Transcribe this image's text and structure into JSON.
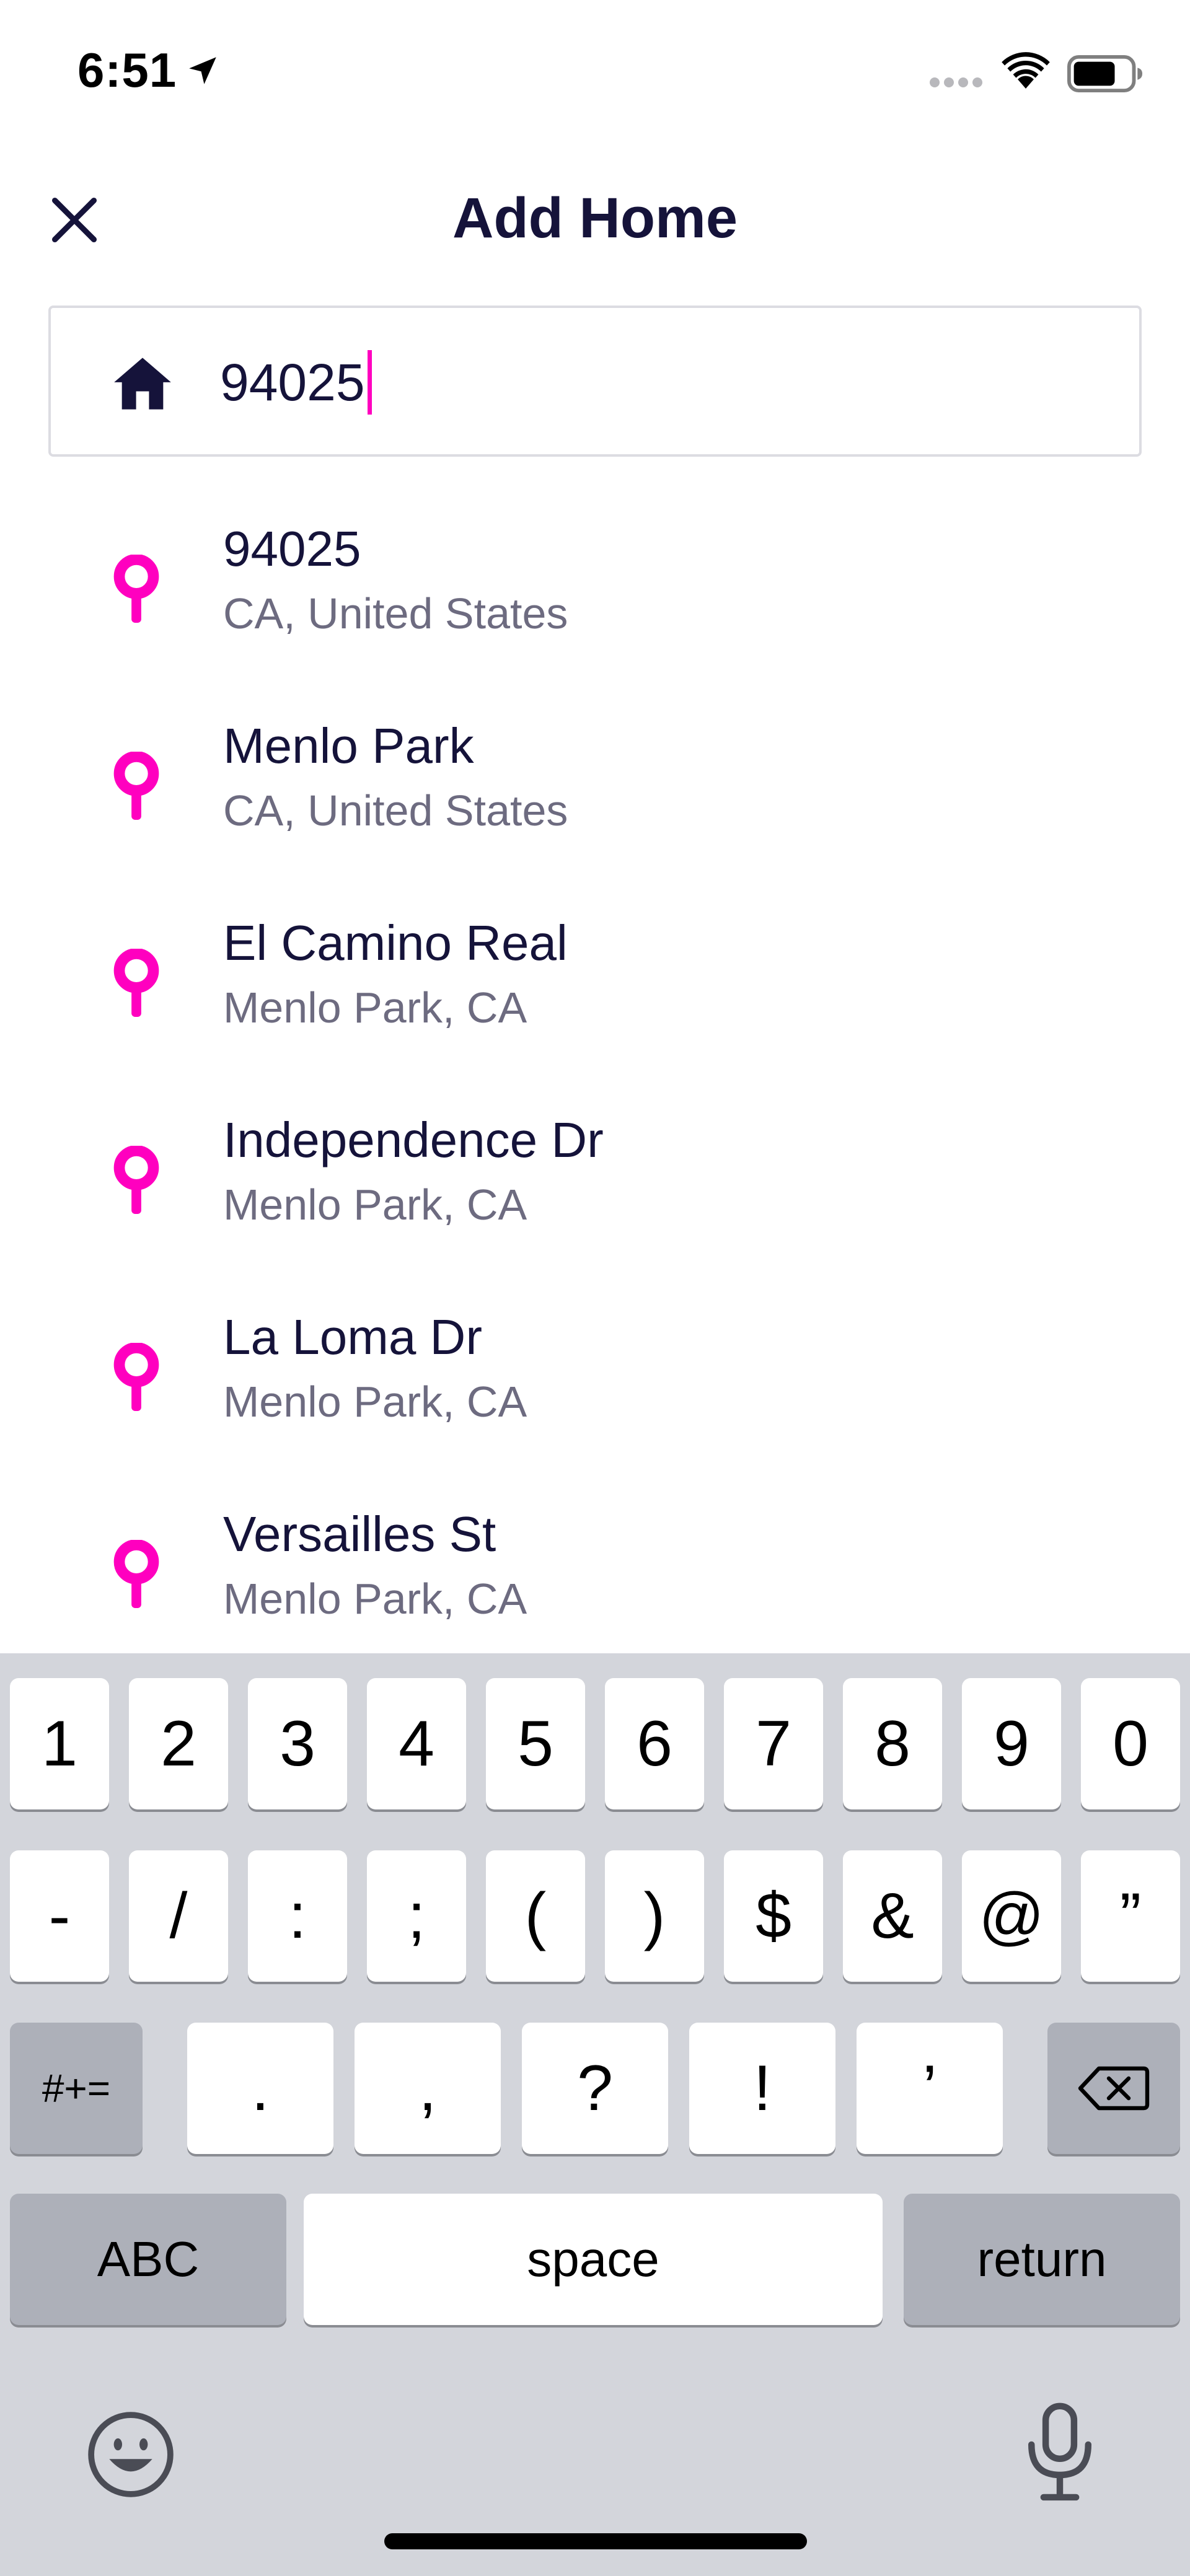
{
  "status_bar": {
    "time": "6:51"
  },
  "header": {
    "title": "Add Home",
    "close_icon": "close-icon"
  },
  "search": {
    "icon": "home-icon",
    "value": "94025"
  },
  "results": [
    {
      "title": "94025",
      "subtitle": "CA, United States"
    },
    {
      "title": "Menlo Park",
      "subtitle": "CA, United States"
    },
    {
      "title": "El Camino Real",
      "subtitle": "Menlo Park, CA"
    },
    {
      "title": "Independence Dr",
      "subtitle": "Menlo Park, CA"
    },
    {
      "title": "La Loma Dr",
      "subtitle": "Menlo Park, CA"
    },
    {
      "title": "Versailles St",
      "subtitle": "Menlo Park, CA"
    }
  ],
  "keyboard": {
    "row1": [
      "1",
      "2",
      "3",
      "4",
      "5",
      "6",
      "7",
      "8",
      "9",
      "0"
    ],
    "row2": [
      "-",
      "/",
      ":",
      ";",
      "(",
      ")",
      "$",
      "&",
      "@",
      "”"
    ],
    "row3_mode": "#+=",
    "row3": [
      ".",
      ",",
      "?",
      "!",
      "’"
    ],
    "abc_label": "ABC",
    "space_label": "space",
    "return_label": "return"
  },
  "colors": {
    "accent": "#ff00bf",
    "title": "#15133a",
    "subtitle": "#6d6b80",
    "keyboard_bg": "#d3d5db"
  }
}
